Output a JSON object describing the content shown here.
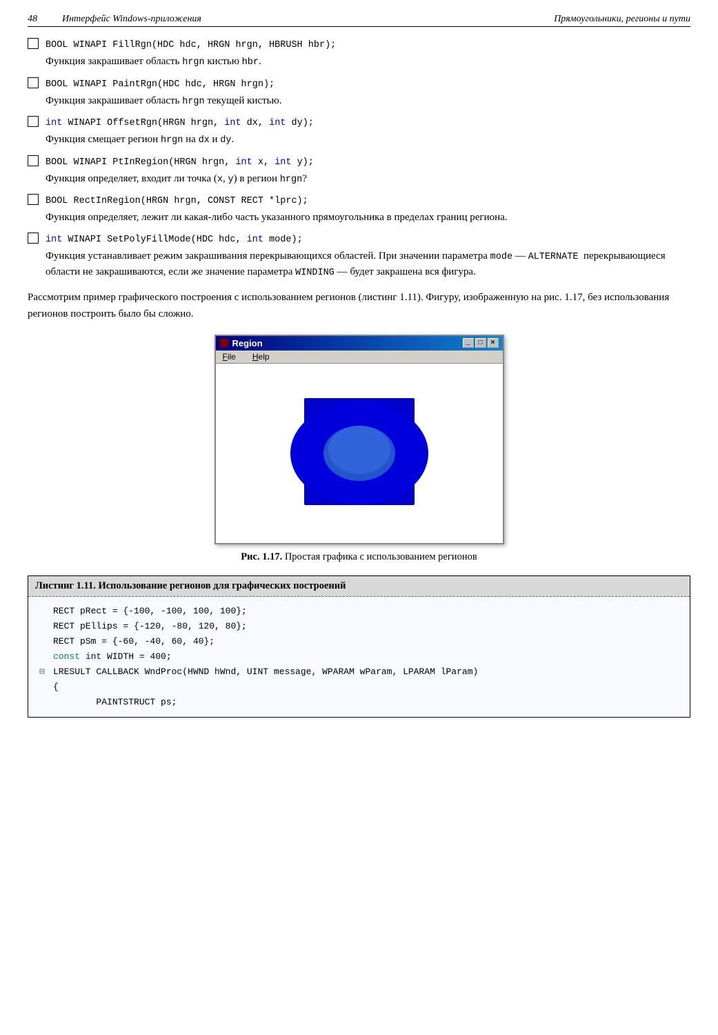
{
  "header": {
    "page_number": "48",
    "left_text": "Интерфейс Windows-приложения",
    "right_text": "Прямоугольники, регионы и пути"
  },
  "bullets": [
    {
      "id": "b1",
      "code": "BOOL WINAPI FillRgn(HDC hdc, HRGN hrgn, HBRUSH hbr);",
      "desc_parts": [
        {
          "text": "Функция закрашивает область ",
          "type": "normal"
        },
        {
          "text": "hrgn",
          "type": "code"
        },
        {
          "text": " кистью ",
          "type": "normal"
        },
        {
          "text": "hbr",
          "type": "code"
        },
        {
          "text": ".",
          "type": "normal"
        }
      ]
    },
    {
      "id": "b2",
      "code": "BOOL WINAPI PaintRgn(HDC hdc, HRGN hrgn);",
      "desc_parts": [
        {
          "text": "Функция закрашивает область ",
          "type": "normal"
        },
        {
          "text": "hrgn",
          "type": "code"
        },
        {
          "text": " текущей кистью.",
          "type": "normal"
        }
      ]
    },
    {
      "id": "b3",
      "code_parts": [
        {
          "text": "int",
          "type": "blue"
        },
        {
          "text": " WINAPI OffsetRgn(HRGN hrgn, ",
          "type": "mono"
        },
        {
          "text": "int",
          "type": "blue"
        },
        {
          "text": " dx, ",
          "type": "mono"
        },
        {
          "text": "int",
          "type": "blue"
        },
        {
          "text": " dy);",
          "type": "mono"
        }
      ],
      "desc_parts": [
        {
          "text": "Функция смещает регион ",
          "type": "normal"
        },
        {
          "text": "hrgn",
          "type": "code"
        },
        {
          "text": " на ",
          "type": "normal"
        },
        {
          "text": "dx",
          "type": "code"
        },
        {
          "text": "  и ",
          "type": "normal"
        },
        {
          "text": "dy",
          "type": "code"
        },
        {
          "text": ".",
          "type": "normal"
        }
      ]
    },
    {
      "id": "b4",
      "code_parts": [
        {
          "text": "BOOL WINAPI PtInRegion(HRGN hrgn, ",
          "type": "mono"
        },
        {
          "text": "int",
          "type": "blue"
        },
        {
          "text": " x, ",
          "type": "mono"
        },
        {
          "text": "int",
          "type": "blue"
        },
        {
          "text": " y);",
          "type": "mono"
        }
      ],
      "desc_parts": [
        {
          "text": "Функция определяет, входит ли точка (",
          "type": "normal"
        },
        {
          "text": "x",
          "type": "code"
        },
        {
          "text": ", ",
          "type": "normal"
        },
        {
          "text": "y",
          "type": "code"
        },
        {
          "text": ") в регион ",
          "type": "normal"
        },
        {
          "text": "hrgn",
          "type": "code"
        },
        {
          "text": "?",
          "type": "normal"
        }
      ]
    },
    {
      "id": "b5",
      "code": "BOOL RectInRegion(HRGN hrgn, CONST RECT *lprc);",
      "desc": "Функция определяет, лежит ли какая-либо часть указанного прямоугольника в пределах границ региона."
    },
    {
      "id": "b6",
      "code_parts": [
        {
          "text": "int",
          "type": "blue"
        },
        {
          "text": " WINAPI SetPolyFillMode(HDC hdc, ",
          "type": "mono"
        },
        {
          "text": "int",
          "type": "blue"
        },
        {
          "text": " mode);",
          "type": "mono"
        }
      ],
      "desc_long": true,
      "desc_text": "Функция устанавливает режим закрашивания перекрывающихся областей. При значении параметра mode — ALTERNATE перекрывающиеся области не закрашиваются, если же значение параметра WINDING — будет закрашена вся фигура."
    }
  ],
  "paragraph": "Рассмотрим пример графического построения с использованием регионов (листинг 1.11). Фигуру, изображенную на рис. 1.17, без использования регионов построить было бы сложно.",
  "window": {
    "title": "Region",
    "controls": [
      "-",
      "□",
      "×"
    ],
    "menu_items": [
      "File",
      "Help"
    ]
  },
  "figure_caption": "Рис. 1.17. Простая графика с использованием регионов",
  "listing": {
    "title": "Листинг 1.11. Использование регионов для графических построений",
    "lines": [
      {
        "type": "normal",
        "text": "RECT pRect = {-100, -100, 100, 100};"
      },
      {
        "type": "normal",
        "text": "RECT pEllips = {-120, -80, 120, 80};"
      },
      {
        "type": "normal",
        "text": "RECT pSm = {-60, -40, 60, 40};"
      },
      {
        "type": "blue_const",
        "text": "const int WIDTH = 400;"
      },
      {
        "type": "minus",
        "text": "LRESULT CALLBACK WndProc(HWND hWnd, UINT message, WPARAM wParam, LPARAM lParam)"
      },
      {
        "type": "normal",
        "text": "{"
      },
      {
        "type": "indent",
        "text": "PAINTSTRUCT ps;"
      }
    ]
  }
}
